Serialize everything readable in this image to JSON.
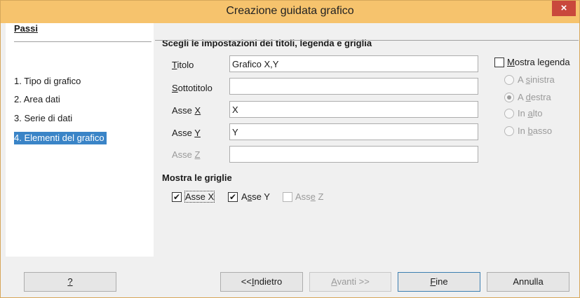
{
  "window": {
    "title": "Creazione guidata grafico",
    "close_label": "×"
  },
  "steps": {
    "heading": "Passi",
    "items": [
      "1. Tipo di grafico",
      "2. Area dati",
      "3. Serie di dati",
      "4. Elementi del grafico"
    ],
    "active_index": 3
  },
  "section_titles": "Scegli le impostazioni dei titoli, legenda e griglia",
  "fields": {
    "titolo": {
      "label": "Titolo",
      "value": "Grafico X,Y"
    },
    "sottotitolo": {
      "label": "Sottotitolo",
      "value": ""
    },
    "asse_x": {
      "label": "Asse X",
      "value": "X"
    },
    "asse_y": {
      "label": "Asse Y",
      "value": "Y"
    },
    "asse_z": {
      "label": "Asse Z",
      "value": ""
    }
  },
  "legend": {
    "checkbox_label": "Mostra legenda",
    "checked": false,
    "options": [
      {
        "label": "A sinistra",
        "selected": false
      },
      {
        "label": "A destra",
        "selected": true
      },
      {
        "label": "In alto",
        "selected": false
      },
      {
        "label": "In basso",
        "selected": false
      }
    ]
  },
  "grid": {
    "heading": "Mostra le griglie",
    "asse_x": {
      "label": "Asse X",
      "checked": true
    },
    "asse_y": {
      "label": "Asse Y",
      "checked": true
    },
    "asse_z": {
      "label": "Asse Z",
      "checked": false
    }
  },
  "buttons": {
    "help": "?",
    "back": "<<Indietro",
    "next": "Avanti >>",
    "finish": "Fine",
    "cancel": "Annulla"
  },
  "checkmark": "✔"
}
